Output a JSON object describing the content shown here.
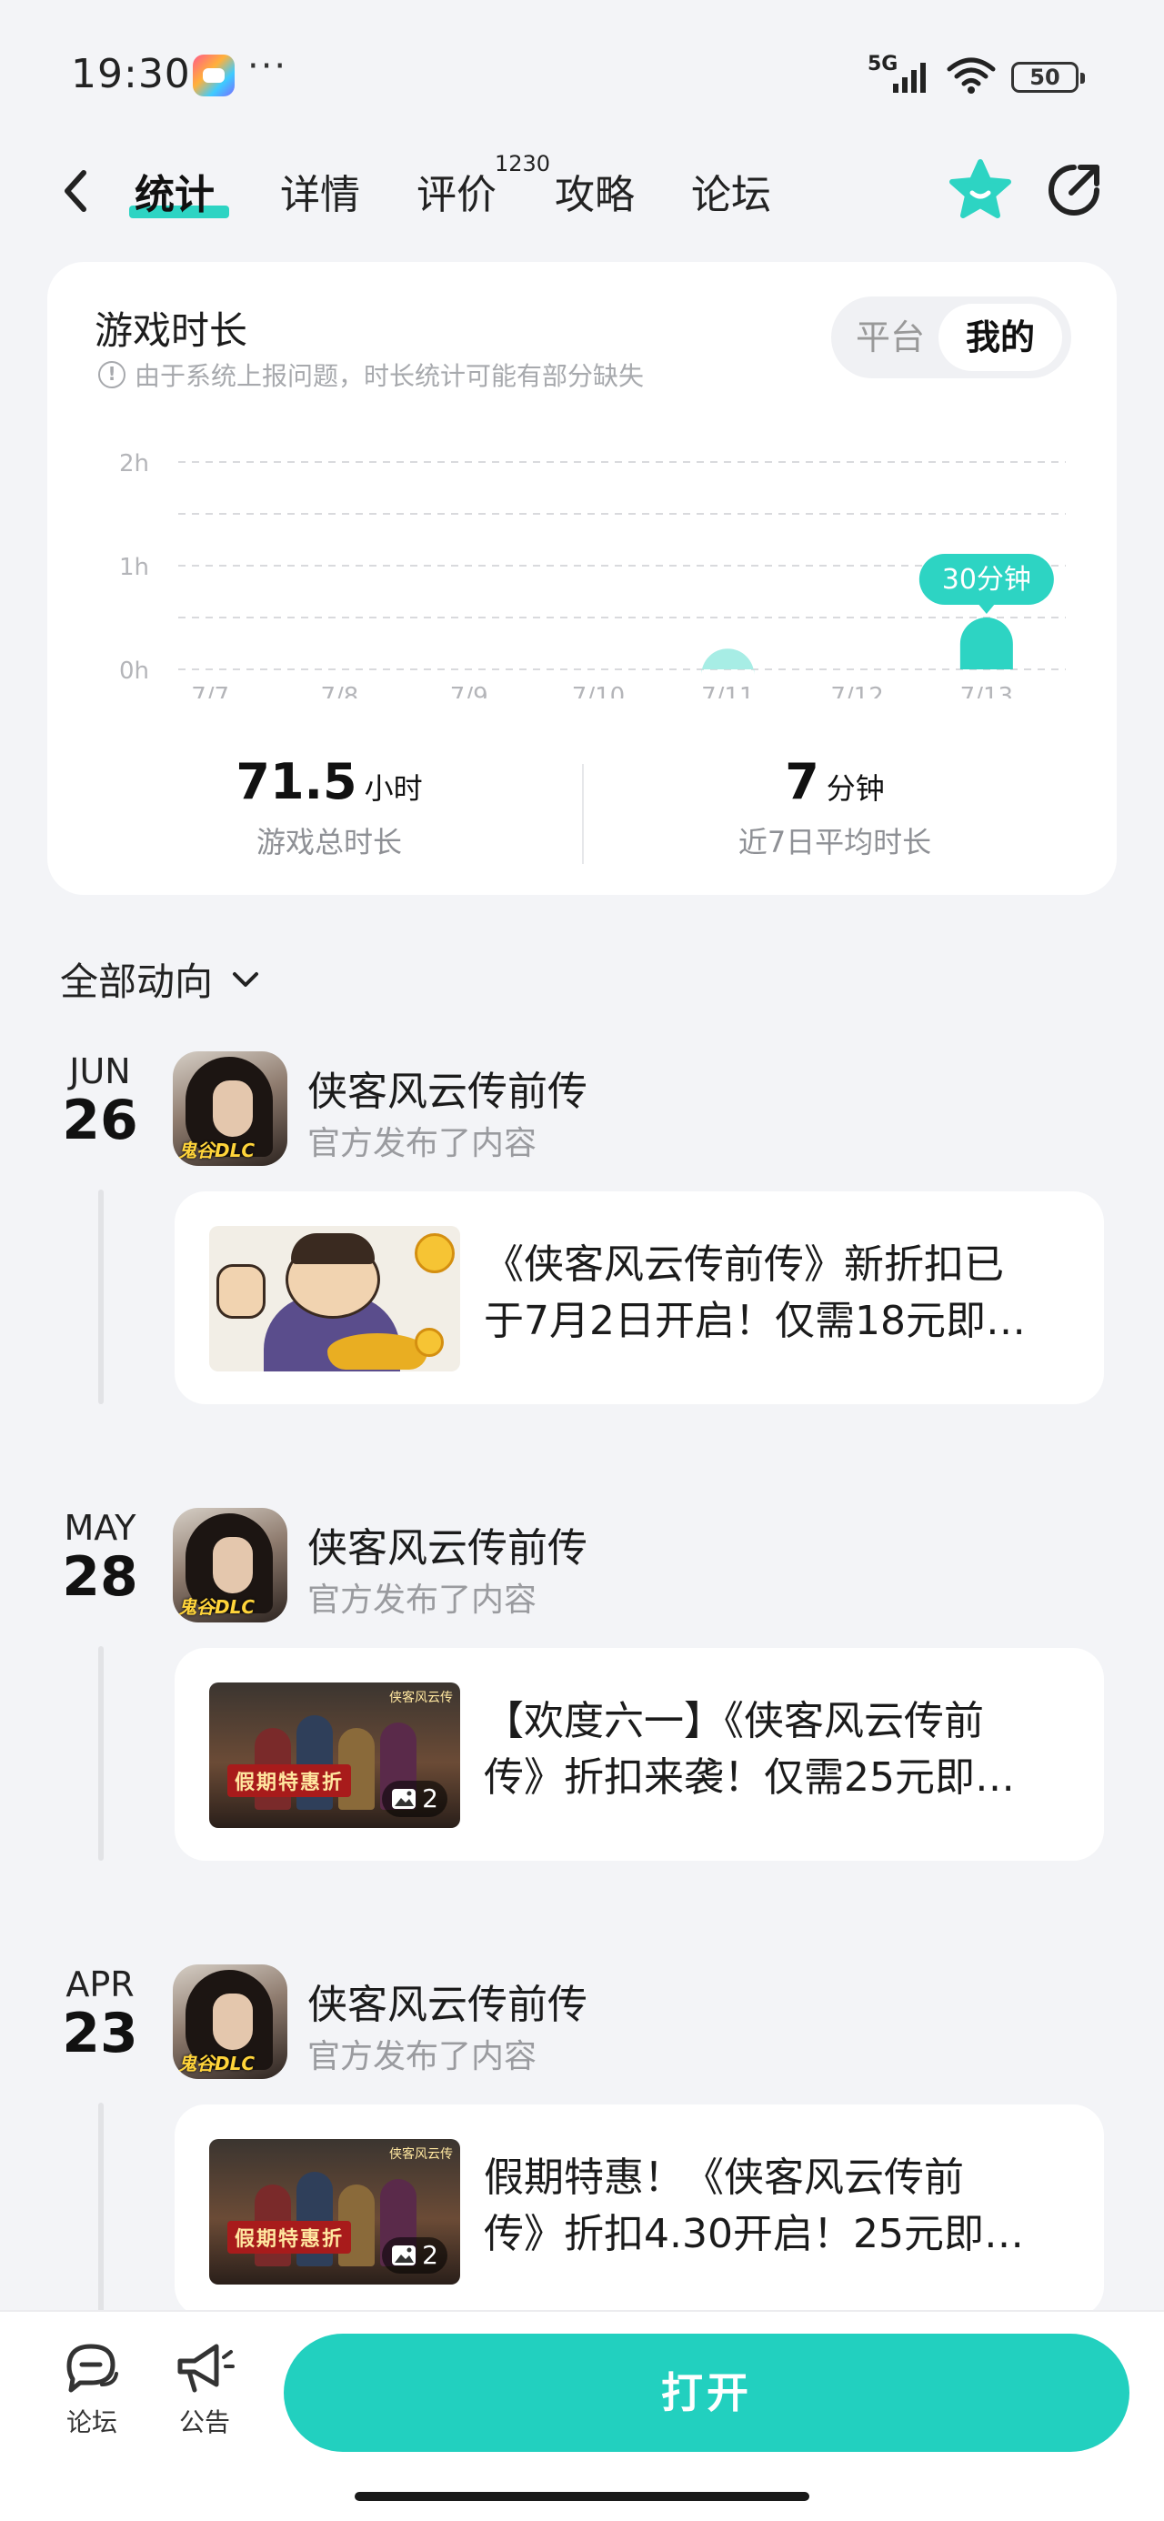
{
  "status_bar": {
    "time": "19:30",
    "more": "···",
    "network": "5G",
    "battery": "50",
    "icons": [
      "game-app-icon",
      "signal-icon",
      "wifi-icon",
      "battery-icon"
    ]
  },
  "nav": {
    "tabs": [
      {
        "label": "统计",
        "active": true
      },
      {
        "label": "详情",
        "active": false
      },
      {
        "label": "评价",
        "active": false,
        "badge": "1230"
      },
      {
        "label": "攻略",
        "active": false
      },
      {
        "label": "论坛",
        "active": false
      }
    ],
    "icons": [
      "back-icon",
      "favorite-icon",
      "share-icon"
    ]
  },
  "stats": {
    "title": "游戏时长",
    "note": "由于系统上报问题，时长统计可能有部分缺失",
    "toggle": {
      "platform": "平台",
      "mine": "我的",
      "selected": "我的"
    },
    "total": {
      "value": "71.5",
      "unit": "小时",
      "label": "游戏总时长"
    },
    "average": {
      "value": "7",
      "unit": "分钟",
      "label": "近7日平均时长"
    }
  },
  "chart_data": {
    "type": "bar",
    "categories": [
      "7/7",
      "7/8",
      "7/9",
      "7/10",
      "7/11",
      "7/12",
      "7/13"
    ],
    "values": [
      0,
      0,
      0,
      0,
      0.2,
      0,
      0.5
    ],
    "y_ticks": [
      "0h",
      "1h",
      "2h"
    ],
    "ylim": [
      0,
      2
    ],
    "grid": true,
    "annotation": {
      "category": "7/13",
      "text": "30分钟"
    },
    "colors": {
      "bar": "#a7ede5",
      "bar_selected": "#2dd4c3"
    }
  },
  "feed": {
    "filter_label": "全部动向",
    "items": [
      {
        "month": "JUN",
        "day": "26",
        "game": "侠客风云传前传",
        "sub": "官方发布了内容",
        "text_line1": "《侠客风云传前传》新折扣已",
        "text_line2": "于7月2日开启！仅需18元即…",
        "thumb": "merchant"
      },
      {
        "month": "MAY",
        "day": "28",
        "game": "侠客风云传前传",
        "sub": "官方发布了内容",
        "text_line1": "【欢度六一】《侠客风云传前",
        "text_line2": "传》折扣来袭！仅需25元即…",
        "thumb": "poster",
        "image_count": "2",
        "poster_banner": "假期特惠折",
        "poster_logo": "侠客风云传"
      },
      {
        "month": "APR",
        "day": "23",
        "game": "侠客风云传前传",
        "sub": "官方发布了内容",
        "text_line1": "假期特惠！《侠客风云传前",
        "text_line2": "传》折扣4.30开启！25元即…",
        "thumb": "poster",
        "image_count": "2",
        "poster_banner": "假期特惠折",
        "poster_logo": "侠客风云传"
      }
    ],
    "avatar_badge": "鬼谷DLC"
  },
  "bottom_bar": {
    "forum_label": "论坛",
    "notice_label": "公告",
    "open_label": "打开"
  },
  "colors": {
    "accent": "#2dd4c3",
    "button": "#22d0bf",
    "background": "#f3f4f7"
  }
}
